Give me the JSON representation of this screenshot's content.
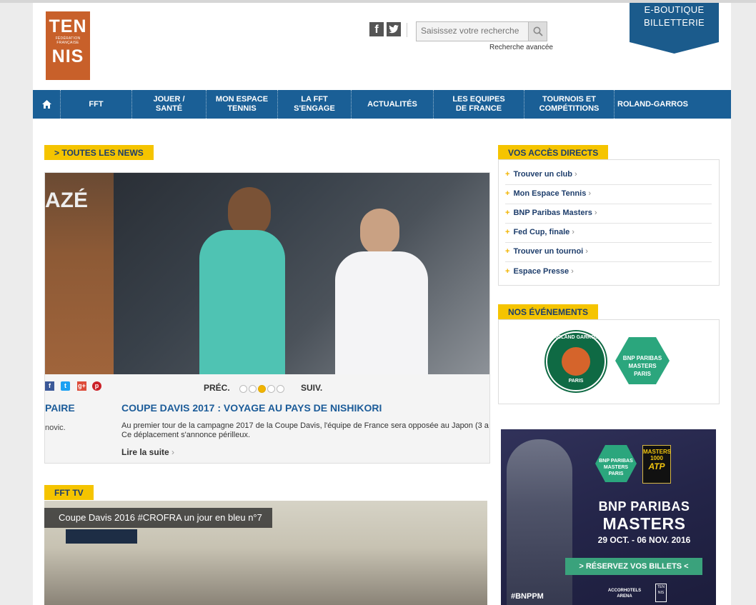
{
  "header": {
    "logo": {
      "line1": "TEN",
      "line2a": "FÉDÉRATION",
      "line2b": "FRANÇAISE",
      "line3": "NIS"
    },
    "social": [
      "facebook-icon",
      "twitter-icon"
    ],
    "search": {
      "placeholder": "Saisissez votre recherche",
      "value": "",
      "advanced_label": "Recherche avancée"
    },
    "shop": {
      "line1": "E-BOUTIQUE",
      "line2": "BILLETTERIE"
    }
  },
  "nav": {
    "home_icon": "home-icon",
    "items": [
      {
        "label": "FFT"
      },
      {
        "label": "JOUER / SANTÉ"
      },
      {
        "label": "MON ESPACE TENNIS"
      },
      {
        "label": "LA FFT S'ENGAGE"
      },
      {
        "label": "ACTUALITÉS"
      },
      {
        "label": "LES EQUIPES DE FRANCE"
      },
      {
        "label": "TOURNOIS ET COMPÉTITIONS"
      },
      {
        "label": "ROLAND-GARROS"
      }
    ]
  },
  "news": {
    "section_label": "> TOUTES LES NEWS",
    "photo_left_text": "AZÉ",
    "prev_label": "PRÉC.",
    "next_label": "SUIV.",
    "slides_count": 5,
    "active_slide": 3,
    "prev_title": "PAIRE",
    "prev_sub": "novic.",
    "headline": "COUPE DAVIS 2017 : VOYAGE AU PAYS DE NISHIKORI",
    "excerpt_line1": "Au premier tour de la campagne 2017 de la Coupe Davis, l'équipe de France sera opposée au Japon (3 a",
    "excerpt_line2": "Ce déplacement s'annonce périlleux.",
    "read_more": "Lire la suite"
  },
  "tv": {
    "section_label": "FFT TV",
    "caption": "Coupe Davis 2016 #CROFRA un jour en bleu n°7"
  },
  "access": {
    "section_label": "VOS ACCÈS DIRECTS",
    "items": [
      {
        "label": "Trouver un club"
      },
      {
        "label": "Mon Espace Tennis"
      },
      {
        "label": "BNP Paribas Masters"
      },
      {
        "label": "Fed Cup, finale"
      },
      {
        "label": "Trouver un tournoi"
      },
      {
        "label": "Espace Presse"
      }
    ]
  },
  "events": {
    "section_label": "NOS ÉVÉNEMENTS",
    "rg": {
      "top": "ROLAND GARROS",
      "bottom": "PARIS"
    },
    "bnp": {
      "l1": "BNP PARIBAS",
      "l2": "MASTERS",
      "l3": "PARIS"
    }
  },
  "ad": {
    "bnp": {
      "l1": "BNP PARIBAS",
      "l2": "MASTERS",
      "l3": "PARIS"
    },
    "atp_top": "MASTERS 1000",
    "atp": "ATP",
    "title1": "BNP PARIBAS",
    "title2": "MASTERS",
    "dates": "29 OCT. - 06 NOV. 2016",
    "cta": "> RÉSERVEZ VOS BILLETS <",
    "hashtag": "#BNPPM",
    "venue_l1": "ACCORHOTELS",
    "venue_l2": "ARENA",
    "tn": "TEN NIS"
  },
  "colors": {
    "nav_blue": "#1a5f96",
    "tag_yellow": "#f5c400",
    "link_blue": "#1c5c99",
    "logo_orange": "#c8602a",
    "rg_green": "#0f6a44",
    "bnp_green": "#2ba67d"
  }
}
